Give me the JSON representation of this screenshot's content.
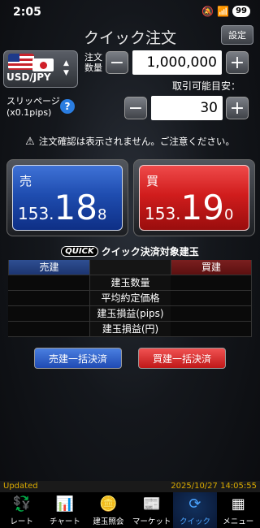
{
  "status": {
    "time": "2:05",
    "battery": "99"
  },
  "header": {
    "title": "クイック注文",
    "settings_label": "設定"
  },
  "pair": {
    "label": "USD/JPY"
  },
  "qty": {
    "label_line1": "注文",
    "label_line2": "数量",
    "value": "1,000,000",
    "minus": "−",
    "plus": "+"
  },
  "available": {
    "label": "取引可能目安："
  },
  "slippage": {
    "label_line1": "スリッページ",
    "label_line2": "(x0.1pips)",
    "value": "30",
    "minus": "−",
    "plus": "+"
  },
  "notice": "注文確認は表示されません。ご注意ください。",
  "sell": {
    "side": "売",
    "main": "153.",
    "big": "18",
    "small": "8"
  },
  "buy": {
    "side": "買",
    "main": "153.",
    "big": "19",
    "small": "0"
  },
  "quick": {
    "logo": "QUICK",
    "title": "クイック決済対象建玉"
  },
  "positions": {
    "sell_header": "売建",
    "buy_header": "買建",
    "rows": [
      "建玉数量",
      "平均約定価格",
      "建玉損益(pips)",
      "建玉損益(円)"
    ]
  },
  "settle": {
    "sell_label": "売建一括決済",
    "buy_label": "買建一括決済"
  },
  "footer": {
    "updated": "Updated",
    "timestamp": "2025/10/27 14:05:55"
  },
  "tabs": [
    {
      "label": "レート",
      "icon": "rate-icon"
    },
    {
      "label": "チャート",
      "icon": "chart-icon"
    },
    {
      "label": "建玉照会",
      "icon": "position-icon"
    },
    {
      "label": "マーケット",
      "icon": "news-icon"
    },
    {
      "label": "クイック",
      "icon": "quick-icon"
    },
    {
      "label": "メニュー",
      "icon": "menu-icon"
    }
  ]
}
